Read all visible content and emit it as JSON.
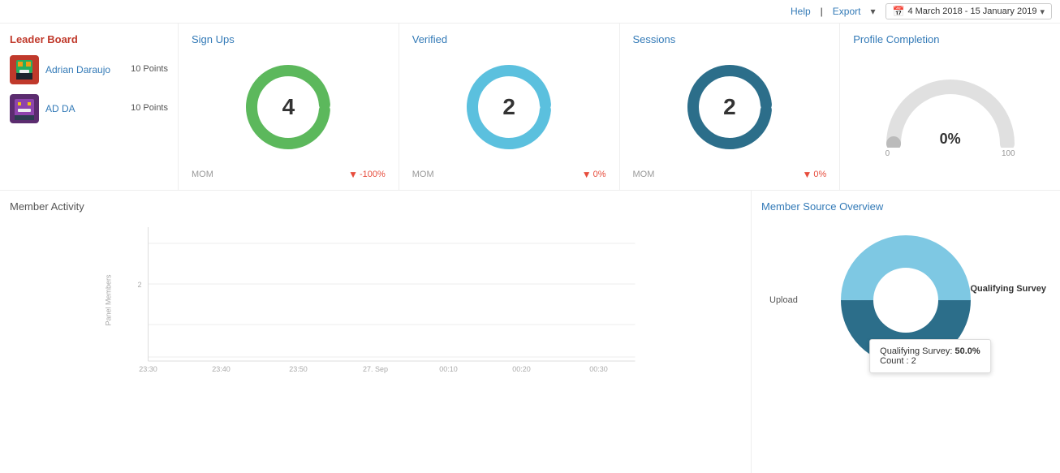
{
  "topbar": {
    "help_label": "Help",
    "export_label": "Export",
    "date_range": "4 March 2018 - 15 January 2019"
  },
  "leaderboard": {
    "title": "Leader Board",
    "members": [
      {
        "name": "Adrian Daraujo",
        "points": "10 Points",
        "avatar_color": "#c0392b",
        "avatar_secondary": "#e74c3c"
      },
      {
        "name": "AD DA",
        "points": "10 Points",
        "avatar_color": "#5b2c6f",
        "avatar_secondary": "#8e44ad"
      }
    ]
  },
  "signups": {
    "title": "Sign Ups",
    "value": "4",
    "mom_label": "MOM",
    "mom_value": "-100%",
    "donut_color": "#5cb85c",
    "donut_bg": "#e8f5e9"
  },
  "verified": {
    "title": "Verified",
    "value": "2",
    "mom_label": "MOM",
    "mom_value": "0%",
    "donut_color": "#5bc0de",
    "donut_bg": "#e3f4fa"
  },
  "sessions": {
    "title": "Sessions",
    "value": "2",
    "mom_label": "MOM",
    "mom_value": "0%",
    "donut_color": "#2c6e8a",
    "donut_bg": "#d9eaf3"
  },
  "profile_completion": {
    "title": "Profile Completion",
    "value": "0%",
    "min_label": "0",
    "max_label": "100"
  },
  "member_activity": {
    "title": "Member Activity",
    "y_axis_label": "Panel Members",
    "x_labels": [
      "23:30",
      "23:40",
      "23:50",
      "27. Sep",
      "00:10",
      "00:20",
      "00:30"
    ],
    "y_labels": [
      "2"
    ]
  },
  "member_source": {
    "title": "Member Source Overview",
    "label_left": "Upload",
    "label_right": "Qualifying Survey",
    "tooltip": {
      "label": "Qualifying Survey:",
      "percent": "50.0%",
      "count_label": "Count :",
      "count_value": "2"
    },
    "segments": [
      {
        "label": "Upload",
        "color": "#7ec8e3",
        "percent": 50
      },
      {
        "label": "Qualifying Survey",
        "color": "#2c6e8a",
        "percent": 50
      }
    ]
  }
}
